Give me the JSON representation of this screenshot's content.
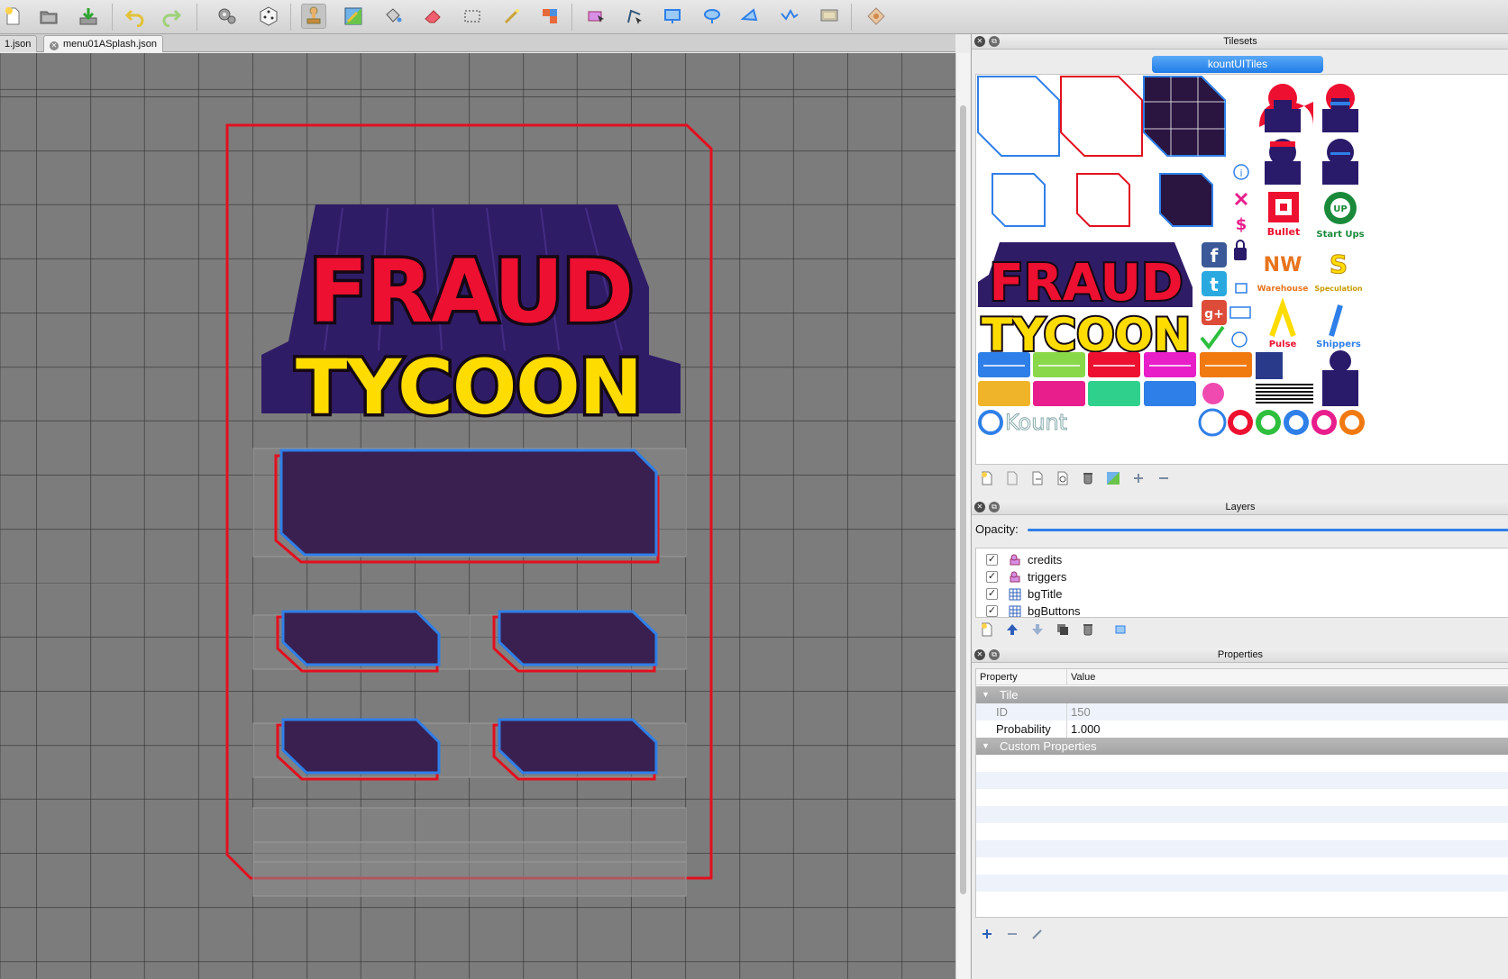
{
  "toolbar": {
    "items": [
      {
        "name": "new-map-button",
        "icon": "new-document-icon"
      },
      {
        "name": "open-button",
        "icon": "folder-icon"
      },
      {
        "name": "save-button",
        "icon": "download-save-icon"
      },
      {
        "name": "undo-button",
        "icon": "undo-icon"
      },
      {
        "name": "redo-button",
        "icon": "redo-icon"
      },
      {
        "name": "command-button",
        "icon": "gears-icon"
      },
      {
        "name": "random-mode-button",
        "icon": "dice-icon"
      },
      {
        "name": "stamp-brush-button",
        "icon": "stamp-icon",
        "active": true
      },
      {
        "name": "terrain-brush-button",
        "icon": "terrain-icon"
      },
      {
        "name": "bucket-fill-button",
        "icon": "bucket-icon"
      },
      {
        "name": "eraser-button",
        "icon": "eraser-icon"
      },
      {
        "name": "rectangle-select-button",
        "icon": "rect-select-icon"
      },
      {
        "name": "magic-wand-button",
        "icon": "magic-wand-icon"
      },
      {
        "name": "select-same-tile-button",
        "icon": "same-tile-icon"
      },
      {
        "name": "select-objects-button",
        "icon": "select-objects-icon"
      },
      {
        "name": "edit-polygons-button",
        "icon": "edit-polygon-icon"
      },
      {
        "name": "insert-rectangle-button",
        "icon": "insert-rect-icon"
      },
      {
        "name": "insert-ellipse-button",
        "icon": "insert-ellipse-icon"
      },
      {
        "name": "insert-polygon-button",
        "icon": "insert-polygon-icon"
      },
      {
        "name": "insert-polyline-button",
        "icon": "insert-polyline-icon"
      },
      {
        "name": "insert-tile-button",
        "icon": "insert-tile-icon"
      },
      {
        "name": "insert-image-button",
        "icon": "insert-image-icon"
      }
    ]
  },
  "tabs": [
    {
      "label": "1.json",
      "active": false
    },
    {
      "label": "menu01ASplash.json",
      "active": true
    }
  ],
  "map": {
    "title_line1": "FRAUD",
    "title_line2": "TYCOON",
    "colors": {
      "frame": "#e2101f",
      "button_border": "#2f7fe8",
      "button_fill": "#3a2050",
      "title_red": "#ee1030",
      "title_yellow": "#ffdc00",
      "title_cyan": "#7fd6f4",
      "bg_purple": "#2f1c66"
    }
  },
  "tilesets": {
    "panel_title": "Tilesets",
    "active_tileset": "kountUITiles",
    "tile_text": {
      "fraud": "FRAUD",
      "tycoon": "TYCOON",
      "bullet": "Bullet",
      "startups": "Start Ups",
      "nw": "NW",
      "nw_sub": "Warehouse",
      "speculation": "Speculation",
      "pulse": "Pulse",
      "shippers": "Shippers",
      "kount": "Kount",
      "info": "i",
      "dollar": "$"
    }
  },
  "layers": {
    "panel_title": "Layers",
    "opacity_label": "Opacity:",
    "opacity": 1.0,
    "items": [
      {
        "name": "credits",
        "type": "object",
        "visible": true
      },
      {
        "name": "triggers",
        "type": "object",
        "visible": true
      },
      {
        "name": "bgTitle",
        "type": "tile",
        "visible": true
      },
      {
        "name": "bgButtons",
        "type": "tile",
        "visible": true
      }
    ]
  },
  "properties": {
    "panel_title": "Properties",
    "col_property": "Property",
    "col_value": "Value",
    "group_tile": "Tile",
    "rows": [
      {
        "name": "ID",
        "value": "150",
        "readonly": true
      },
      {
        "name": "Probability",
        "value": "1.000",
        "readonly": false
      }
    ],
    "group_custom": "Custom Properties"
  }
}
